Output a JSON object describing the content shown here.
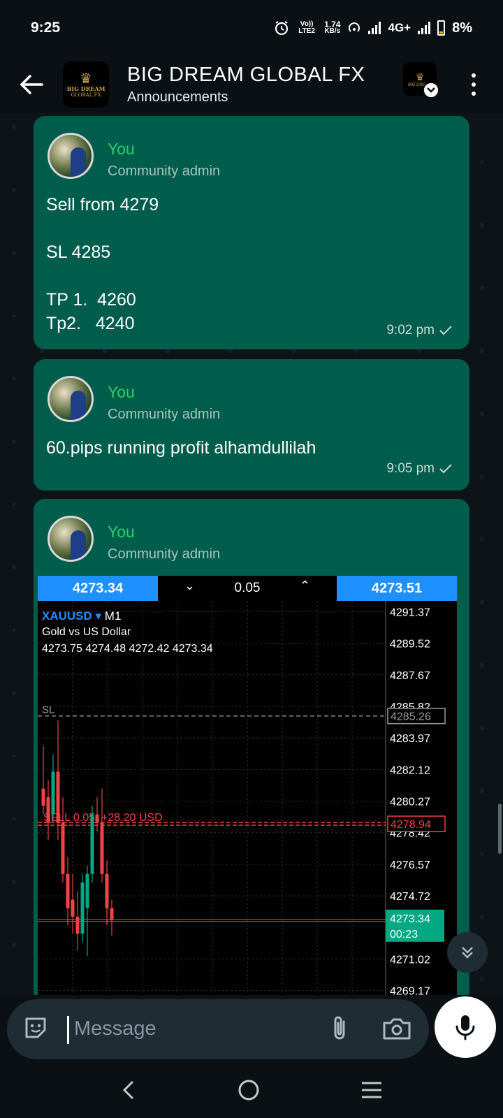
{
  "status_bar": {
    "time": "9:25",
    "volte": "Vo)) LTE2",
    "speed": "1.74",
    "speed_unit": "KB/s",
    "network": "4G+",
    "battery": "8%"
  },
  "header": {
    "title": "BIG DREAM GLOBAL FX",
    "subtitle": "Announcements",
    "logo_text": "BIG DREAM",
    "logo_sub": "GLOBAL FX"
  },
  "messages": [
    {
      "sender": "You",
      "role": "Community admin",
      "lines": [
        "Sell from 4279",
        "",
        "SL 4285",
        "",
        "TP 1.  4260",
        "Tp2.   4240"
      ],
      "time": "9:02 pm"
    },
    {
      "sender": "You",
      "role": "Community admin",
      "lines": [
        "60.pips running profit alhamdullilah"
      ],
      "time": "9:05 pm"
    },
    {
      "sender": "You",
      "role": "Community admin"
    }
  ],
  "trade_panel": {
    "bid": "4273.34",
    "lot": "0.05",
    "ask": "4273.51"
  },
  "chart_data": {
    "type": "candlestick",
    "symbol": "XAUUSD",
    "timeframe": "M1",
    "description": "Gold vs US Dollar",
    "ohlc": "4273.75 4274.48 4272.42 4273.34",
    "y_ticks": [
      "4291.37",
      "4289.52",
      "4287.67",
      "4285.82",
      "4283.97",
      "4282.12",
      "4280.27",
      "4278.42",
      "4276.57",
      "4274.72",
      "4271.02",
      "4269.17"
    ],
    "ylim": [
      4268.5,
      4292.0
    ],
    "sl_label": "SL",
    "sl_price": "4285.26",
    "sl_value": 4285.26,
    "order_label": "SELL 0.05, +28.20 USD",
    "order_price": "4278.94",
    "order_value": 4278.94,
    "current_price": "4273.34",
    "countdown": "00:23",
    "current_value": 4273.34,
    "candles": [
      {
        "o": 4281.0,
        "h": 4283.5,
        "l": 4279.5,
        "c": 4280.0
      },
      {
        "o": 4280.5,
        "h": 4281.5,
        "l": 4278.0,
        "c": 4279.0
      },
      {
        "o": 4279.5,
        "h": 4283.0,
        "l": 4279.0,
        "c": 4282.0
      },
      {
        "o": 4282.0,
        "h": 4285.0,
        "l": 4278.0,
        "c": 4279.0
      },
      {
        "o": 4279.0,
        "h": 4280.5,
        "l": 4275.5,
        "c": 4276.0
      },
      {
        "o": 4276.0,
        "h": 4277.0,
        "l": 4273.0,
        "c": 4274.0
      },
      {
        "o": 4274.5,
        "h": 4276.0,
        "l": 4272.5,
        "c": 4273.5
      },
      {
        "o": 4273.5,
        "h": 4275.0,
        "l": 4271.5,
        "c": 4272.5
      },
      {
        "o": 4272.5,
        "h": 4276.0,
        "l": 4272.0,
        "c": 4275.5
      },
      {
        "o": 4274.0,
        "h": 4276.5,
        "l": 4271.2,
        "c": 4276.0
      },
      {
        "o": 4276.0,
        "h": 4280.0,
        "l": 4275.5,
        "c": 4279.5
      },
      {
        "o": 4279.5,
        "h": 4280.5,
        "l": 4278.5,
        "c": 4279.0
      },
      {
        "o": 4279.0,
        "h": 4281.0,
        "l": 4275.5,
        "c": 4276.0
      },
      {
        "o": 4276.0,
        "h": 4276.8,
        "l": 4273.0,
        "c": 4274.0
      },
      {
        "o": 4274.0,
        "h": 4274.5,
        "l": 4272.4,
        "c": 4273.3
      }
    ]
  },
  "composer": {
    "placeholder": "Message"
  },
  "colors": {
    "bubble": "#005c4b",
    "sender": "#25d366",
    "bull": "#00a884",
    "bear": "#ef4444",
    "accent": "#1e90ff"
  }
}
